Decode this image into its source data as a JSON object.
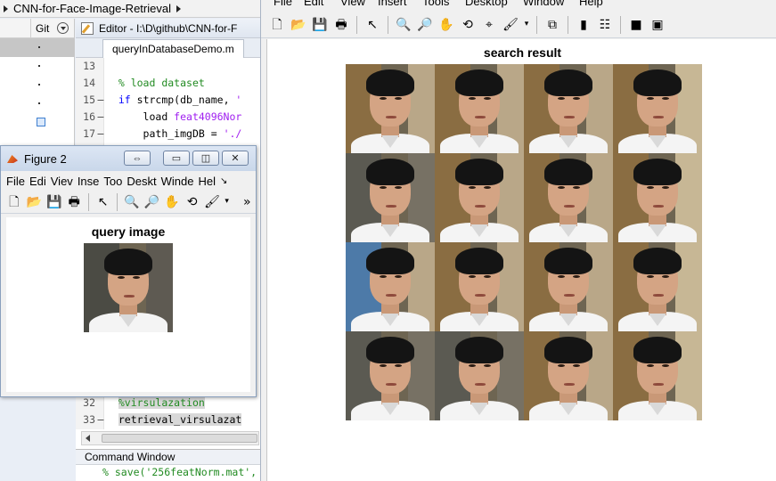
{
  "breadcrumb": {
    "project": "CNN-for-Face-Image-Retrieval"
  },
  "folder_panel": {
    "column_label": "Git"
  },
  "editor": {
    "title": "Editor - I:\\D\\github\\CNN-for-F",
    "tab": "queryInDatabaseDemo.m",
    "lines": [
      {
        "n": "13",
        "dash": "",
        "text": ""
      },
      {
        "n": "14",
        "dash": "",
        "text": "% load dataset"
      },
      {
        "n": "15",
        "dash": "–",
        "text": "if strcmp(db_name, '"
      },
      {
        "n": "16",
        "dash": "–",
        "text": "    load feat4096Nor"
      },
      {
        "n": "17",
        "dash": "–",
        "text": "    path_imgDB = './"
      },
      {
        "n": "32",
        "dash": "",
        "text": "%virsulazation"
      },
      {
        "n": "33",
        "dash": "–",
        "text": "retrieval_virsulazat"
      }
    ]
  },
  "command_window": {
    "title": "Command Window",
    "line": "% save('256featNorm.mat',"
  },
  "big_figure": {
    "menu": [
      "File",
      "Edit",
      "View",
      "Insert",
      "Tools",
      "Desktop",
      "Window",
      "Help"
    ],
    "axes_title": "search result",
    "results": [
      "face-1",
      "face-2",
      "face-3",
      "face-4",
      "face-5",
      "face-6",
      "face-7",
      "face-8",
      "face-9",
      "face-10",
      "face-11",
      "face-12",
      "face-13",
      "face-14",
      "face-15",
      "face-16"
    ]
  },
  "figure2": {
    "title": "Figure 2",
    "menu": [
      "File",
      "Edi",
      "Viev",
      "Inse",
      "Too",
      "Deskt",
      "Winde",
      "Hel"
    ],
    "axes_title": "query image"
  },
  "colors": {
    "comment": "#228b22",
    "keyword": "#0000ff",
    "string": "#a020f0",
    "window_title": "#c9d7ea"
  }
}
